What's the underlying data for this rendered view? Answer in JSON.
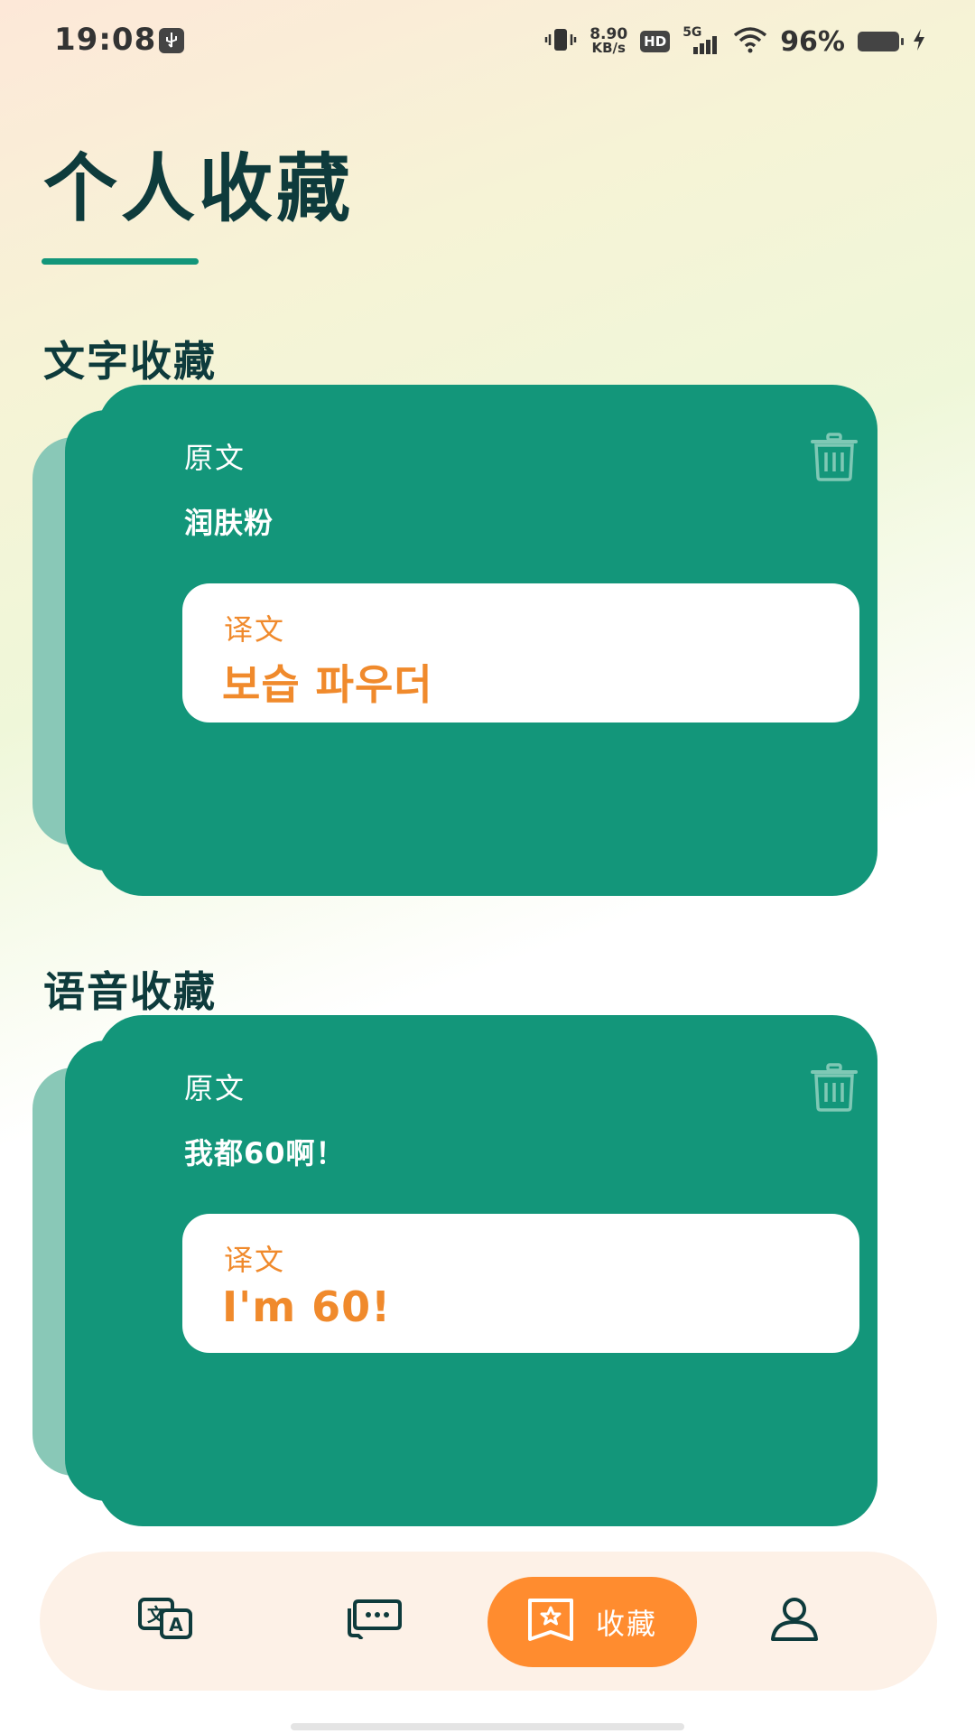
{
  "status_bar": {
    "time": "19:08",
    "net_speed_value": "8.90",
    "net_speed_unit": "KB/s",
    "hd_badge": "HD",
    "network_type": "5G",
    "battery_percent": "96%",
    "icons": [
      "usb-debug-icon",
      "vibrate-icon",
      "signal-icon",
      "wifi-icon",
      "battery-icon",
      "charging-icon"
    ]
  },
  "page": {
    "title": "个人收藏",
    "accent_color": "#13967a",
    "orange_color": "#ff8c2f"
  },
  "sections": [
    {
      "title": "文字收藏",
      "card": {
        "original_label": "原文",
        "original_text": "润肤粉",
        "translation_label": "译文",
        "translation_text": "보습 파우더"
      }
    },
    {
      "title": "语音收藏",
      "card": {
        "original_label": "原文",
        "original_text": "我都60啊！",
        "translation_label": "译文",
        "translation_text": "I'm 60!"
      }
    }
  ],
  "bottom_nav": {
    "items": [
      {
        "icon": "translate-icon",
        "label": ""
      },
      {
        "icon": "chat-icon",
        "label": ""
      },
      {
        "icon": "favorites-icon",
        "label": "收藏",
        "active": true
      },
      {
        "icon": "profile-icon",
        "label": ""
      }
    ]
  }
}
